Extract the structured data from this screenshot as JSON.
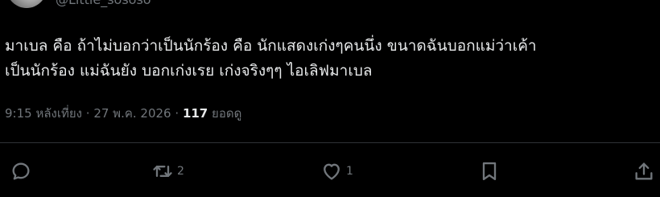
{
  "header": {
    "handle": "@Little_sososo"
  },
  "tweet": {
    "text_lines": [
      "มาเบล คือ ถ้าไม่บอกว่าเป็นนักร้อง คือ นักแสดงเก่งๆคนนึ่ง ขนาดฉันบอกแม่ว่าเค้า",
      "เป็นนักร้อง แม่ฉันยัง บอกเก่งเรย เก่งจริงๆๆ ไอเลิฟมาเบล"
    ],
    "time": "9:15 หลังเที่ยง",
    "separator": "·",
    "date": "27 พ.ค. 2026",
    "views_count": "117",
    "views_label": "ยอดดู"
  },
  "actions": {
    "retweet_count": "2",
    "like_count": "1"
  },
  "colors": {
    "background": "#000000",
    "text": "#e7e9ea",
    "secondary": "#71767b",
    "divider": "#2f3336"
  },
  "icons": [
    "reply-icon",
    "retweet-icon",
    "heart-icon",
    "bookmark-icon",
    "share-icon"
  ]
}
